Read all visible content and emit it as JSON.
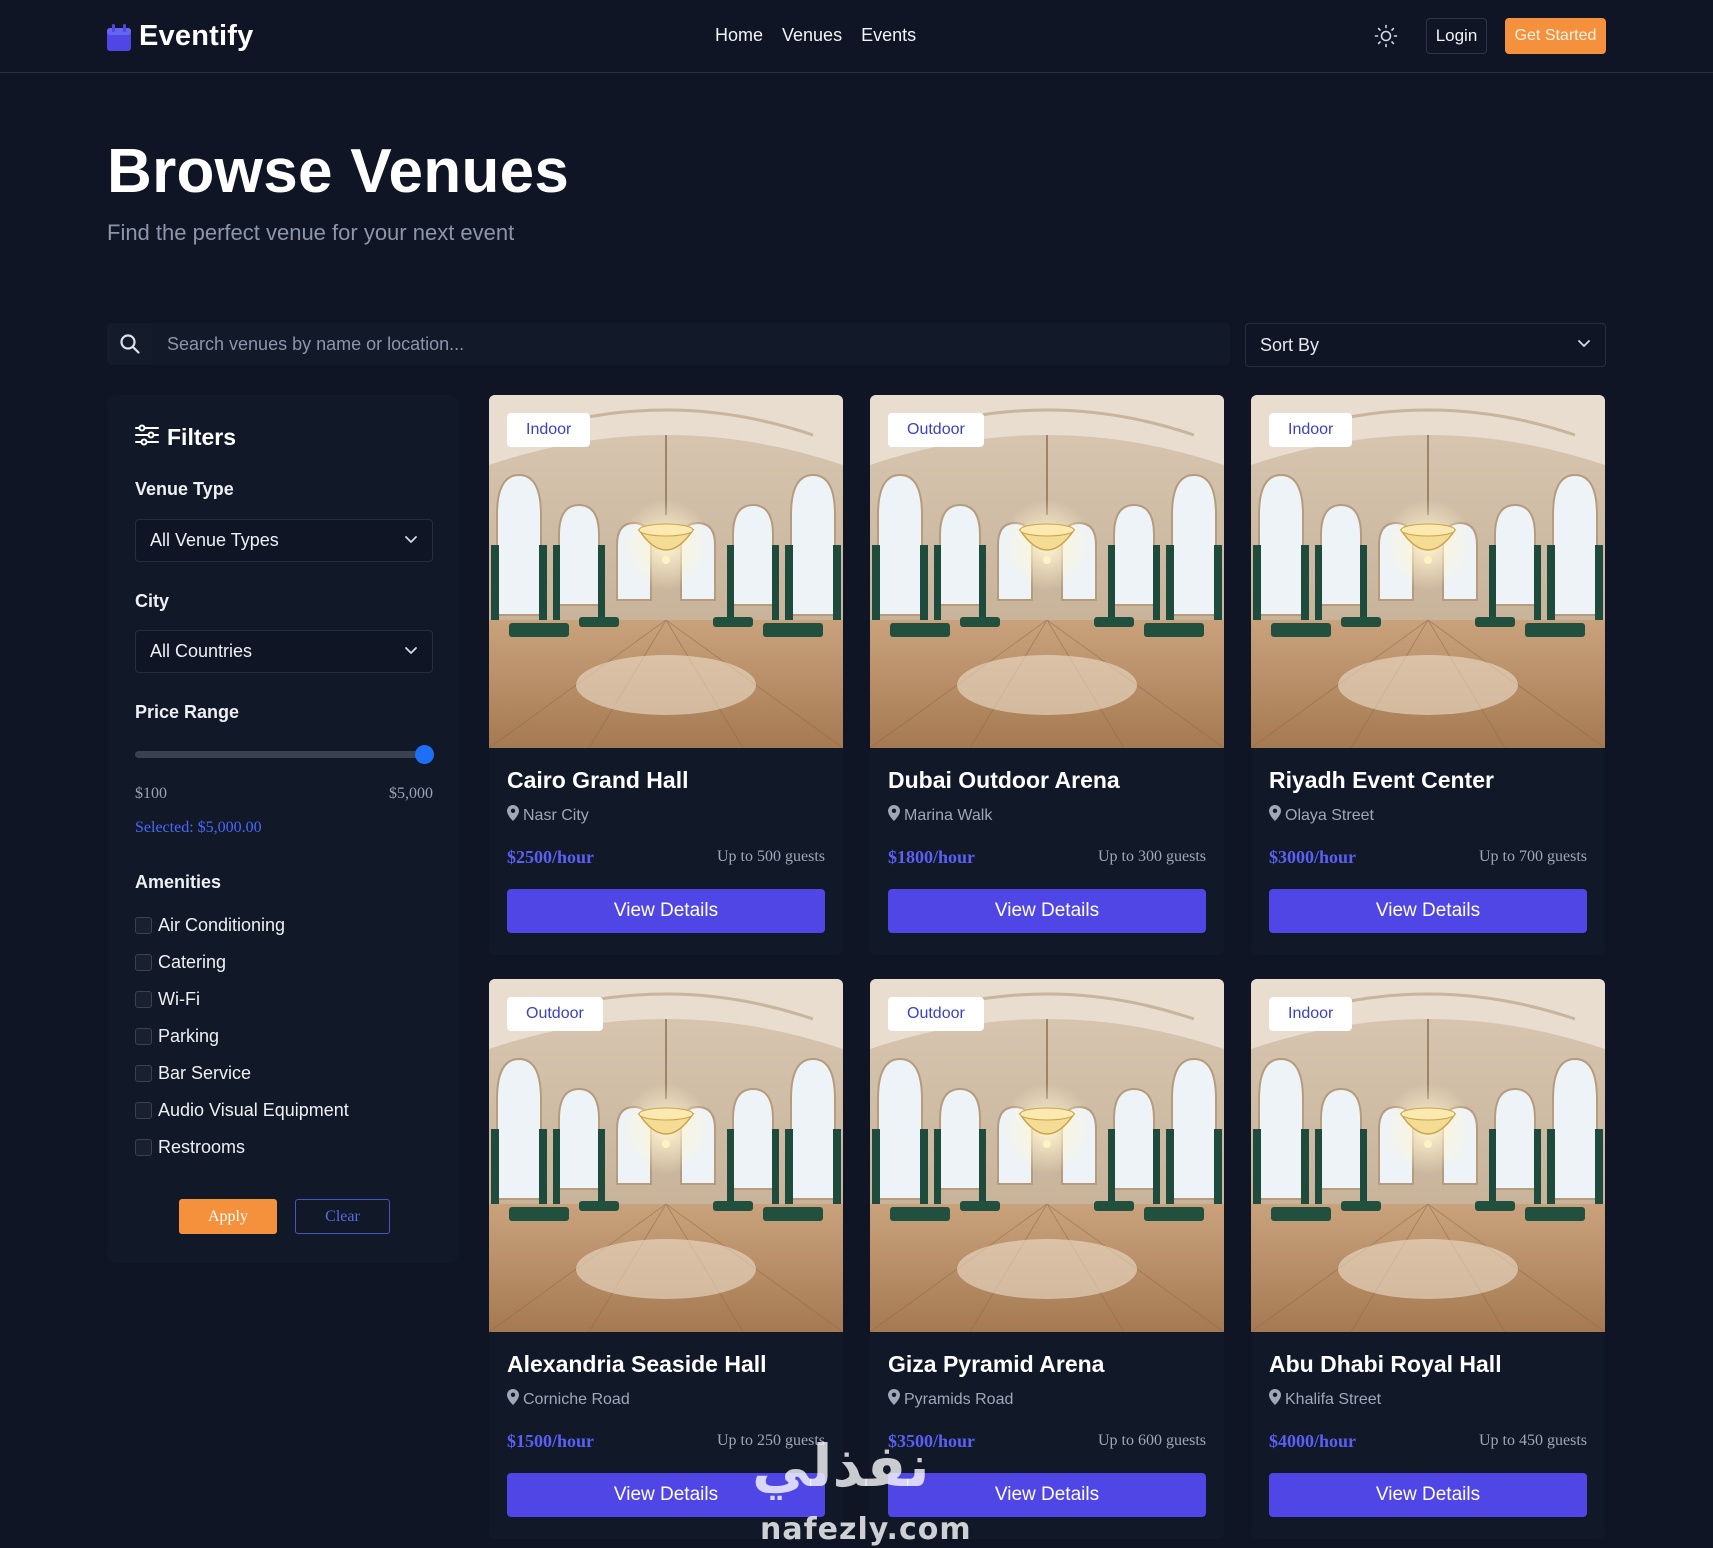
{
  "brand": {
    "name": "Eventify",
    "accent": "#4f46e5"
  },
  "nav": {
    "links": [
      "Home",
      "Venues",
      "Events"
    ],
    "theme_icon": "sun-icon"
  },
  "auth": {
    "login_label": "Login",
    "get_started_label": "Get Started",
    "cta_color": "#f5913c"
  },
  "hero": {
    "title": "Browse Venues",
    "subtitle": "Find the perfect venue for your next event"
  },
  "search": {
    "placeholder": "Search venues by name or location...",
    "value": ""
  },
  "sort": {
    "label": "Sort By"
  },
  "filters": {
    "title": "Filters",
    "venue_type_label": "Venue Type",
    "venue_type_value": "All Venue Types",
    "city_label": "City",
    "city_value": "All Countries",
    "price_label": "Price Range",
    "price_min": "$100",
    "price_max": "$5,000",
    "price_selected": "Selected: $5,000.00",
    "price_fraction": 1.0,
    "amenities_label": "Amenities",
    "amenities": [
      "Air Conditioning",
      "Catering",
      "Wi-Fi",
      "Parking",
      "Bar Service",
      "Audio Visual Equipment",
      "Restrooms"
    ],
    "apply_label": "Apply",
    "clear_label": "Clear"
  },
  "venues": [
    {
      "badge": "Indoor",
      "name": "Cairo Grand Hall",
      "location": "Nasr City",
      "price": "$2500/hour",
      "capacity": "Up to 500 guests",
      "button": "View Details"
    },
    {
      "badge": "Outdoor",
      "name": "Dubai Outdoor Arena",
      "location": "Marina Walk",
      "price": "$1800/hour",
      "capacity": "Up to 300 guests",
      "button": "View Details"
    },
    {
      "badge": "Indoor",
      "name": "Riyadh Event Center",
      "location": "Olaya Street",
      "price": "$3000/hour",
      "capacity": "Up to 700 guests",
      "button": "View Details"
    },
    {
      "badge": "Outdoor",
      "name": "Alexandria Seaside Hall",
      "location": "Corniche Road",
      "price": "$1500/hour",
      "capacity": "Up to 250 guests",
      "button": "View Details"
    },
    {
      "badge": "Outdoor",
      "name": "Giza Pyramid Arena",
      "location": "Pyramids Road",
      "price": "$3500/hour",
      "capacity": "Up to 600 guests",
      "button": "View Details"
    },
    {
      "badge": "Indoor",
      "name": "Abu Dhabi Royal Hall",
      "location": "Khalifa Street",
      "price": "$4000/hour",
      "capacity": "Up to 450 guests",
      "button": "View Details"
    }
  ],
  "watermark": {
    "arabic": "نفذلي",
    "latin": "nafezly.com"
  }
}
